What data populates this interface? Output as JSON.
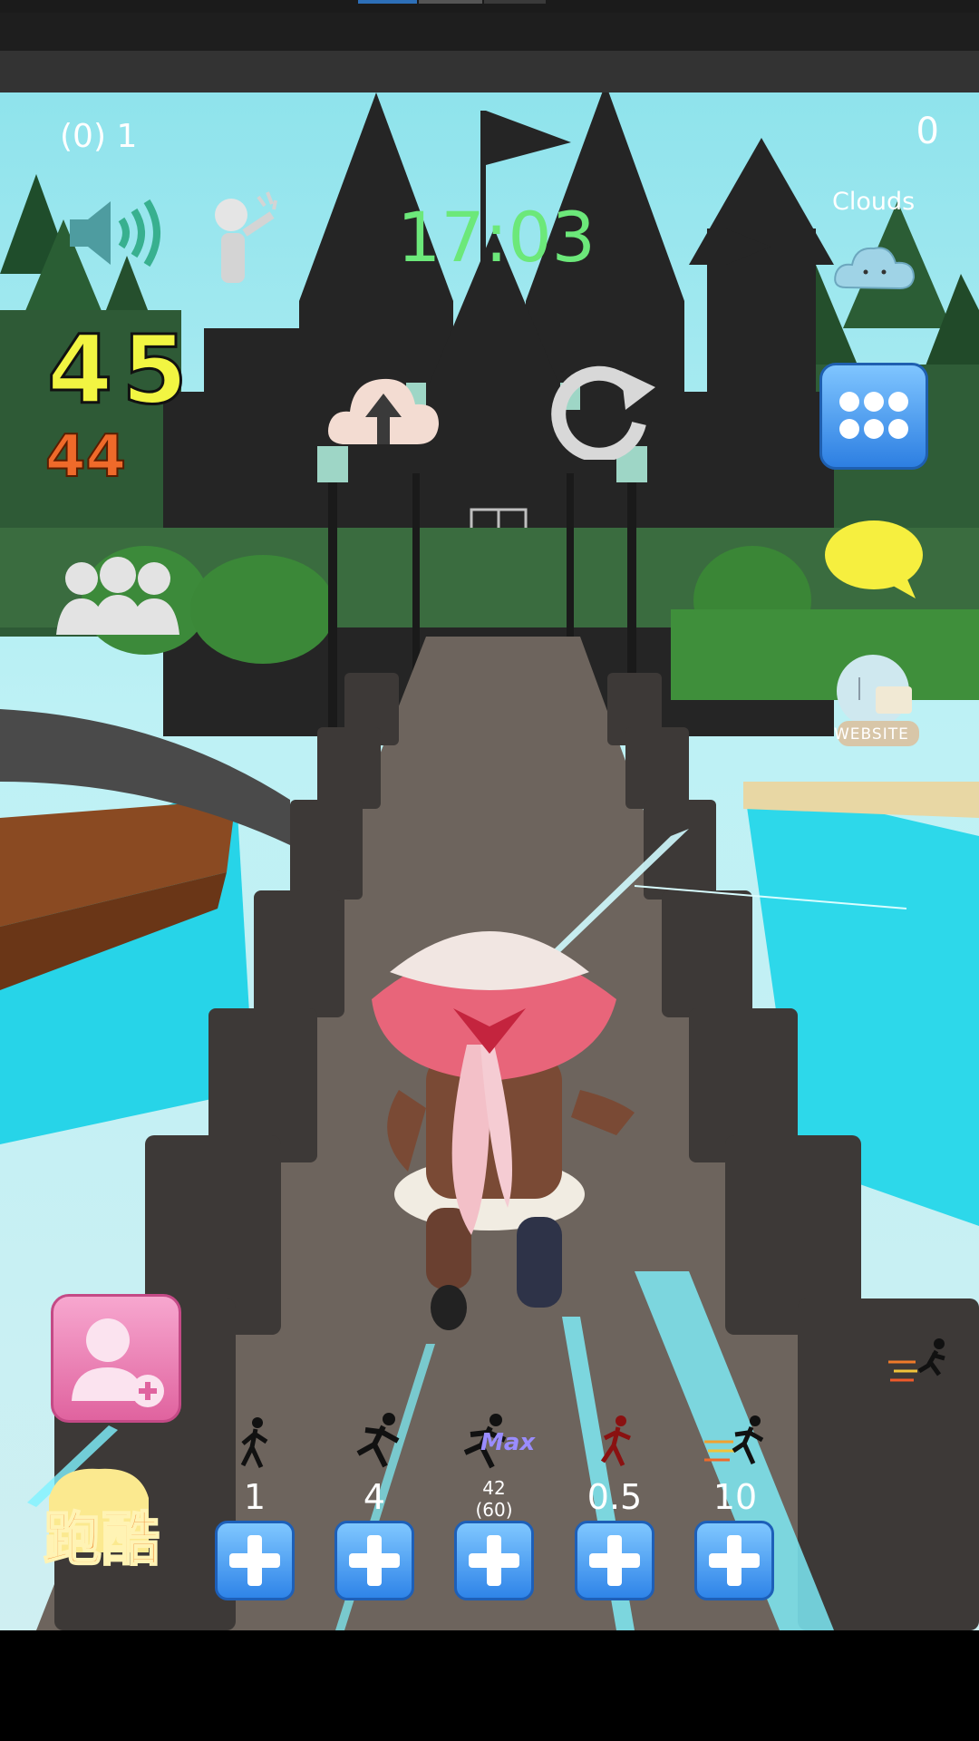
{
  "hud": {
    "level_text": "(0) 1",
    "score_top_right": "0",
    "clock": "17:03",
    "weather_label": "Clouds",
    "big_counter": "45",
    "sub_counter": "44",
    "website_label": "WEBSITE",
    "parkour_label": "跑酷"
  },
  "upgrades": [
    {
      "value": "1",
      "icon": "walk-icon"
    },
    {
      "value": "4",
      "icon": "run-icon"
    },
    {
      "value": "42",
      "sub": "(60)",
      "badge": "Max",
      "icon": "sprint-icon"
    },
    {
      "value": "0.5",
      "icon": "red-runner-icon"
    },
    {
      "value": "10",
      "icon": "dash-runner-icon"
    }
  ],
  "colors": {
    "clock": "#6ce87a",
    "big_counter": "#f2f542",
    "sub_counter": "#ef6a2a",
    "plus_button": "#2f84e8",
    "add_friend_button": "#e77fb3",
    "chat_bubble": "#f6ef3f"
  }
}
